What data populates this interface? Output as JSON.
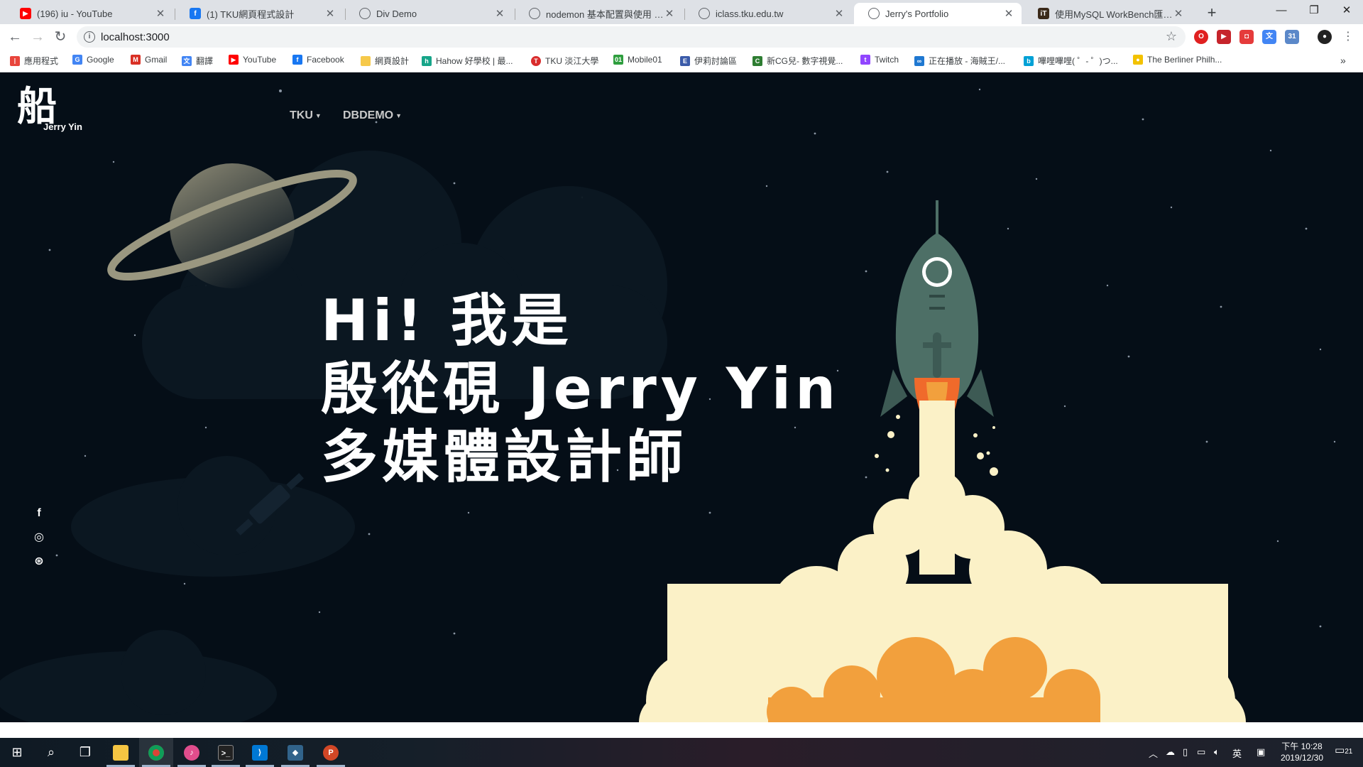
{
  "tabs": [
    {
      "title": "(196) iu - YouTube",
      "icon": "youtube-icon",
      "color": "#ff0000"
    },
    {
      "title": "(1) TKU網頁程式設計",
      "icon": "facebook-icon",
      "color": "#1877f2"
    },
    {
      "title": "Div Demo",
      "icon": "globe-icon",
      "color": "#5f6368"
    },
    {
      "title": "nodemon 基本配置與使用 - 臺...",
      "icon": "globe-icon",
      "color": "#5f6368"
    },
    {
      "title": "iclass.tku.edu.tw",
      "icon": "globe-icon",
      "color": "#5f6368"
    },
    {
      "title": "Jerry's Portfolio",
      "icon": "globe-icon",
      "color": "#5f6368",
      "active": true
    },
    {
      "title": "使用MySQL WorkBench匯入資...",
      "icon": "ithome-icon",
      "color": "#3b2a1a"
    }
  ],
  "toolbar": {
    "url": "localhost:3000"
  },
  "bookmarks": [
    {
      "label": "應用程式",
      "icon": "apps-grid-icon",
      "color": "#e8453c"
    },
    {
      "label": "Google",
      "icon": "google-icon",
      "color": "#4285f4"
    },
    {
      "label": "Gmail",
      "icon": "gmail-icon",
      "color": "#d93025"
    },
    {
      "label": "翻譯",
      "icon": "translate-icon",
      "color": "#4285f4"
    },
    {
      "label": "YouTube",
      "icon": "youtube-icon",
      "color": "#ff0000"
    },
    {
      "label": "Facebook",
      "icon": "facebook-icon",
      "color": "#1877f2"
    },
    {
      "label": "網頁設計",
      "icon": "folder-icon",
      "color": "#f6c94a"
    },
    {
      "label": "Hahow 好學校 | 最...",
      "icon": "hahow-icon",
      "color": "#17a589"
    },
    {
      "label": "TKU 淡江大學",
      "icon": "tku-icon",
      "color": "#d92c2c"
    },
    {
      "label": "Mobile01",
      "icon": "mobile01-icon",
      "color": "#2e9e3e"
    },
    {
      "label": "伊莉討論區",
      "icon": "eyny-icon",
      "color": "#3b5ba9"
    },
    {
      "label": "新CG兒- 數字視覺...",
      "icon": "cg-icon",
      "color": "#2e7d32"
    },
    {
      "label": "Twitch",
      "icon": "twitch-icon",
      "color": "#9146ff"
    },
    {
      "label": "正在播放 - 海賊王/...",
      "icon": "anime-icon",
      "color": "#1f78d1"
    },
    {
      "label": "嗶哩嗶哩( ゜- ゜)つ...",
      "icon": "bilibili-icon",
      "color": "#00a1d6"
    },
    {
      "label": "The Berliner Philh...",
      "icon": "berliner-icon",
      "color": "#f3c200"
    }
  ],
  "site": {
    "logo_glyph": "船",
    "logo_name": "Jerry Yin",
    "nav": [
      "TKU",
      "DBDEMO"
    ],
    "hero_lines": [
      "Hi! 我是",
      "殷從硯 Jerry Yin",
      "多媒體設計師"
    ],
    "social": [
      {
        "glyph": "f",
        "icon": "facebook-icon"
      },
      {
        "glyph": "◎",
        "icon": "instagram-icon"
      },
      {
        "glyph": "⊛",
        "icon": "dribbble-icon"
      }
    ]
  },
  "taskbar": {
    "clock_time": "下午 10:28",
    "clock_date": "2019/12/30",
    "ime": "英",
    "notifications": "21"
  },
  "colors": {
    "page_bg": "#050e17",
    "rocket": "#4d6f66",
    "flame": "#f06a2b",
    "smoke": "#fbf1c7",
    "smoke_inner": "#f2a03d",
    "planet": "#9a9780"
  }
}
